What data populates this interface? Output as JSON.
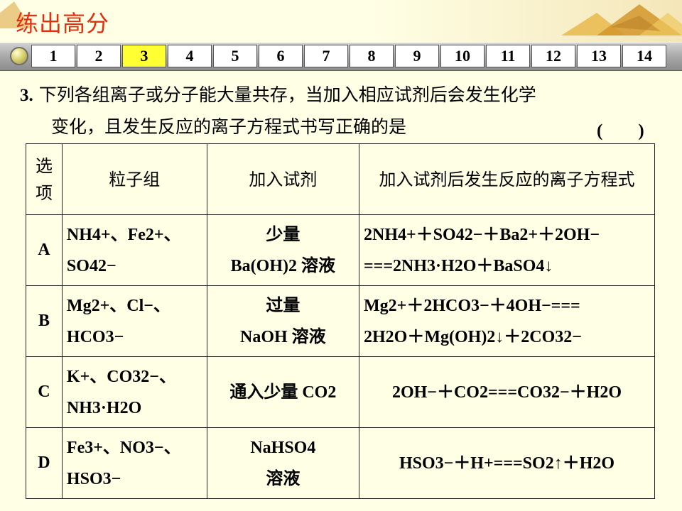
{
  "header": {
    "title": "练出高分",
    "nav_numbers": [
      "1",
      "2",
      "3",
      "4",
      "5",
      "6",
      "7",
      "8",
      "9",
      "10",
      "11",
      "12",
      "13",
      "14"
    ],
    "active_index": 2
  },
  "question": {
    "number": "3",
    "text_line1": "下列各组离子或分子能大量共存，当加入相应试剂后会发生化学",
    "text_line2": "变化，且发生反应的离子方程式书写正确的是",
    "answer_blank": "(　　)"
  },
  "table": {
    "headers": {
      "option": "选项",
      "particles": "粒子组",
      "reagent": "加入试剂",
      "equation": "加入试剂后发生反应的离子方程式"
    },
    "rows": [
      {
        "letter": "A",
        "particles_line1": "NH4+、Fe2+、",
        "particles_line2": "SO42−",
        "reagent_line1": "少量",
        "reagent_line2": "Ba(OH)2 溶液",
        "equation_line1": "2NH4+＋SO42−＋Ba2+＋2OH−",
        "equation_line2": "===2NH3·H2O＋BaSO4↓"
      },
      {
        "letter": "B",
        "particles_line1": "Mg2+、Cl−、",
        "particles_line2": "HCO3−",
        "reagent_line1": "过量",
        "reagent_line2": "NaOH 溶液",
        "equation_line1": "Mg2+＋2HCO3−＋4OH−===",
        "equation_line2": "2H2O＋Mg(OH)2↓＋2CO32−"
      },
      {
        "letter": "C",
        "particles_line1": "K+、CO32−、",
        "particles_line2": "NH3·H2O",
        "reagent_line1": "通入少量 CO2",
        "reagent_line2": "",
        "equation_line1": "2OH−＋CO2===CO32−＋H2O",
        "equation_line2": ""
      },
      {
        "letter": "D",
        "particles_line1": "Fe3+、NO3−、",
        "particles_line2": "HSO3−",
        "reagent_line1": "NaHSO4",
        "reagent_line2": "溶液",
        "equation_line1": "HSO3−＋H+===SO2↑＋H2O",
        "equation_line2": ""
      }
    ]
  }
}
